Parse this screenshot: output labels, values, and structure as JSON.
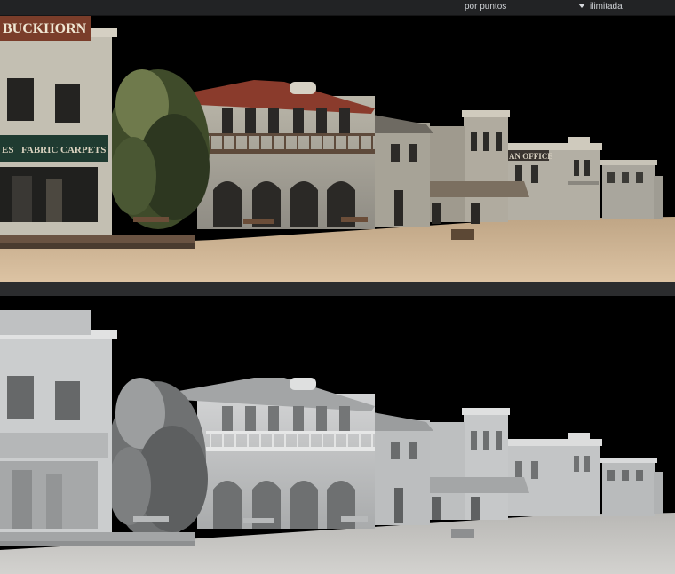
{
  "toolbar": {
    "sampling_label": "por puntos",
    "limit_label": "ilimitada"
  },
  "render_textured": {
    "sign_buckhorn": "BUCKHORN",
    "sign_fabric": "FABRIC",
    "sign_carpets": "CARPETS",
    "sign_es": "ES",
    "sign_office": "AN OFFICE"
  },
  "colors": {
    "sky": "#000000",
    "sand": "#d2b89a",
    "clay_gray": "#c9cbcc"
  }
}
